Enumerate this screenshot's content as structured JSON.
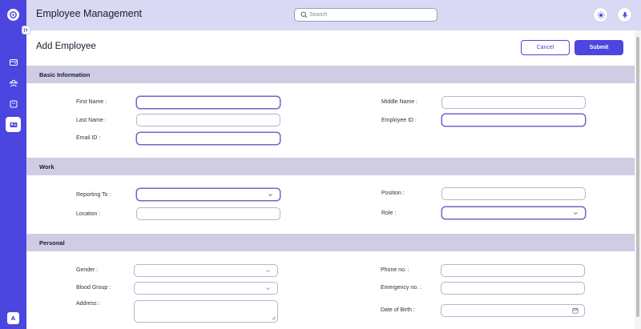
{
  "app": {
    "title": "Employee Management",
    "avatar_initial": "A"
  },
  "search": {
    "placeholder": "Search"
  },
  "page": {
    "title": "Add Employee",
    "cancel_label": "Cancel",
    "submit_label": "Submit"
  },
  "sections": {
    "basic": {
      "title": "Basic Information",
      "first_name": "First Name :",
      "middle_name": "Middle Name :",
      "last_name": "Last Name :",
      "employee_id": "Employee ID :",
      "email_id": "Email ID :"
    },
    "work": {
      "title": "Work",
      "reporting_to": "Reporting To :",
      "position": "Position :",
      "location": "Location :",
      "role": "Role :"
    },
    "personal": {
      "title": "Personal",
      "gender": "Gender :",
      "phone": "Phone no. :",
      "blood_group": "Blood Group :",
      "emergency": "Emergency no. :",
      "address": "Address :",
      "dob": "Date of Birth :"
    }
  },
  "colors": {
    "accent": "#4b46df",
    "topbar": "#d9d9f3",
    "section_bar": "#cfcde3"
  }
}
